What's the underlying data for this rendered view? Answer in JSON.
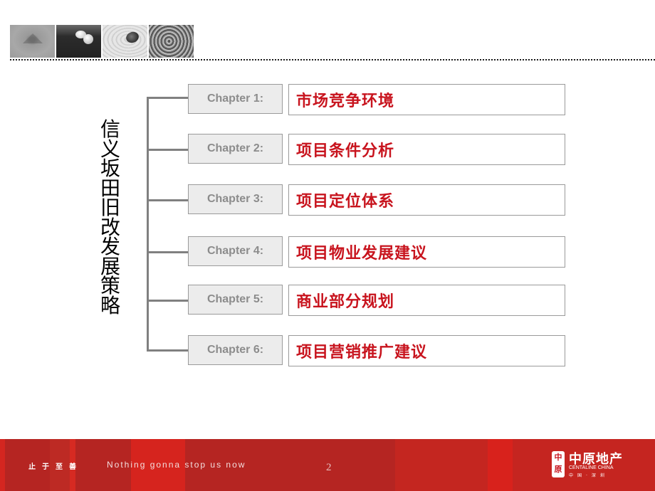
{
  "header": {
    "thumbnails": [
      {
        "name": "sand-mound-image",
        "desc": "sand mound"
      },
      {
        "name": "pebbles-image",
        "desc": "white pebbles on dark"
      },
      {
        "name": "stone-ripples-image",
        "desc": "black stone on rippled sand"
      },
      {
        "name": "concentric-rings-image",
        "desc": "concentric rings"
      }
    ]
  },
  "main": {
    "vertical_title": [
      "信",
      "义",
      "坂",
      "田",
      "旧",
      "改",
      "发",
      "展",
      "策",
      "略"
    ],
    "chapters": [
      {
        "label": "Chapter 1:",
        "title": "市场竞争环境"
      },
      {
        "label": "Chapter 2:",
        "title": "项目条件分析"
      },
      {
        "label": "Chapter 3:",
        "title": "项目定位体系"
      },
      {
        "label": "Chapter 4:",
        "title": "项目物业发展建议"
      },
      {
        "label": "Chapter 5:",
        "title": "商业部分规划"
      },
      {
        "label": "Chapter 6:",
        "title": "项目营销推广建议"
      }
    ]
  },
  "footer": {
    "slogan_cn": "止于至善",
    "slogan_en": "Nothing gonna stop us now",
    "page_number": "2",
    "logo": {
      "mark": "中原",
      "name_cn": "中原地产",
      "name_en": "CENTALINE CHINA",
      "location": "中国·深圳"
    }
  },
  "colors": {
    "accent_red": "#c8141e",
    "footer_red": "#b52522",
    "chapter_gray": "#8c8c8c"
  }
}
